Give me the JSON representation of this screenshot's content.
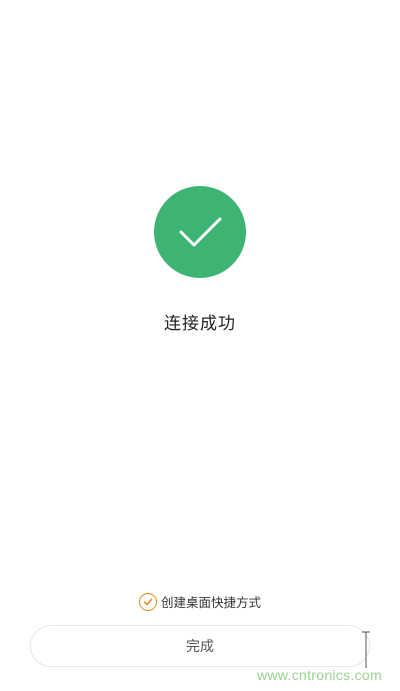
{
  "status": {
    "title": "连接成功",
    "icon": "checkmark-icon",
    "color": "#3db374"
  },
  "shortcut": {
    "checked": true,
    "label": "创建桌面快捷方式",
    "accent_color": "#f08a24"
  },
  "actions": {
    "done_label": "完成"
  },
  "watermark": {
    "text": "www.cntronics.com"
  }
}
